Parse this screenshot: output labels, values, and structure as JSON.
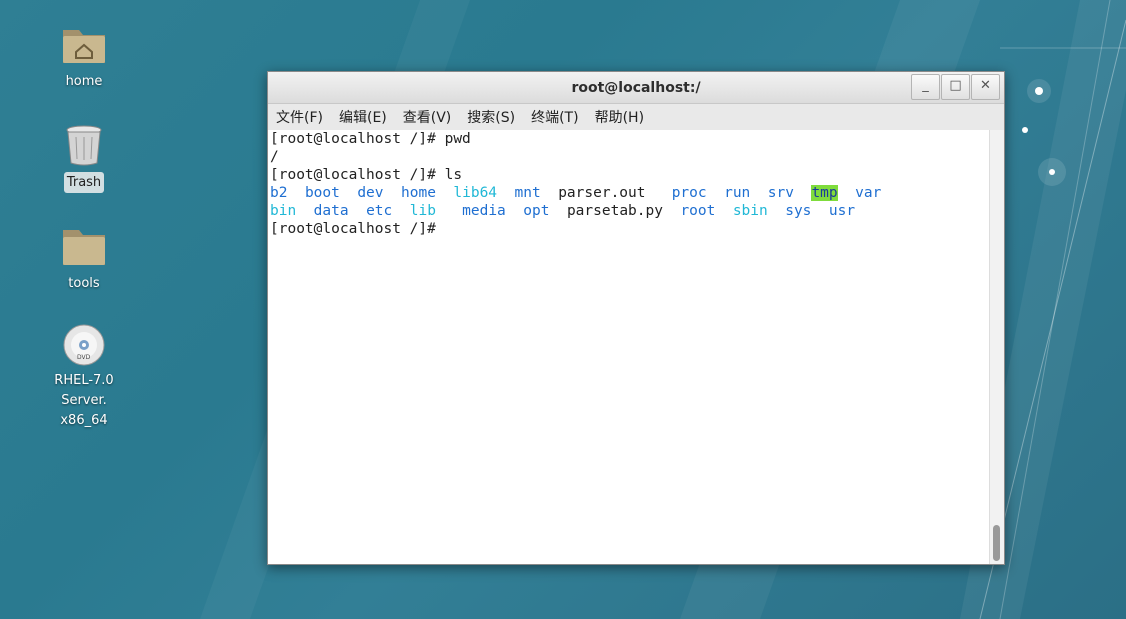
{
  "desktop": {
    "icons": [
      {
        "label": "home"
      },
      {
        "label": "Trash"
      },
      {
        "label": "tools"
      },
      {
        "label_line1": "RHEL-7.0 Server.",
        "label_line2": "x86_64"
      }
    ]
  },
  "window": {
    "title": "root@localhost:/",
    "buttons": {
      "minimize": "_",
      "maximize": "□",
      "close": "✕"
    },
    "menu": [
      "文件(F)",
      "编辑(E)",
      "查看(V)",
      "搜索(S)",
      "终端(T)",
      "帮助(H)"
    ]
  },
  "terminal": {
    "line1": "[root@localhost /]# pwd",
    "line2": "/",
    "line3": "[root@localhost /]# ls",
    "row1": [
      "b2",
      "boot",
      "dev",
      "home",
      "lib64",
      "mnt",
      "parser.out",
      "proc",
      "run",
      "srv",
      "tmp",
      "var"
    ],
    "row2": [
      "bin",
      "data",
      "etc",
      "lib",
      "media",
      "opt",
      "parsetab.py",
      "root",
      "sbin",
      "sys",
      "usr"
    ],
    "line6": "[root@localhost /]# "
  },
  "colors": {
    "dir": "#1f6fd1",
    "symlink": "#21b8d6",
    "sticky_bg": "#7fdc3c"
  }
}
